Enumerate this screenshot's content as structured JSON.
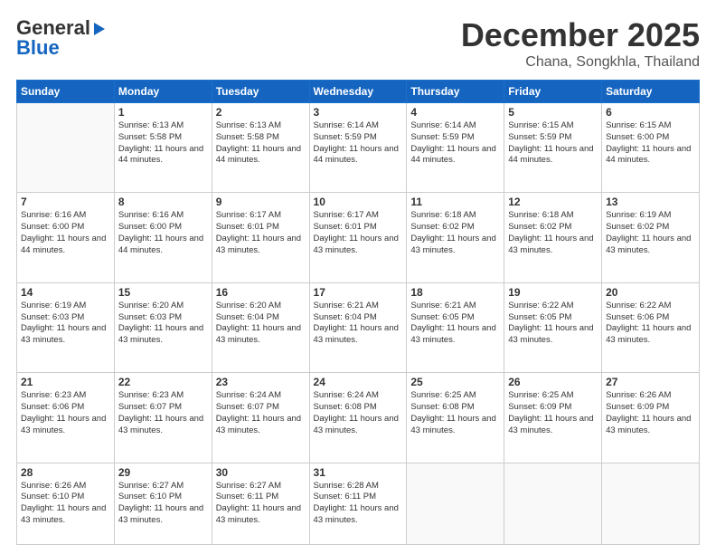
{
  "header": {
    "logo_line1": "General",
    "logo_line2": "Blue",
    "month": "December 2025",
    "location": "Chana, Songkhla, Thailand"
  },
  "days_of_week": [
    "Sunday",
    "Monday",
    "Tuesday",
    "Wednesday",
    "Thursday",
    "Friday",
    "Saturday"
  ],
  "weeks": [
    [
      {
        "day": "",
        "info": ""
      },
      {
        "day": "1",
        "info": "Sunrise: 6:13 AM\nSunset: 5:58 PM\nDaylight: 11 hours and 44 minutes."
      },
      {
        "day": "2",
        "info": "Sunrise: 6:13 AM\nSunset: 5:58 PM\nDaylight: 11 hours and 44 minutes."
      },
      {
        "day": "3",
        "info": "Sunrise: 6:14 AM\nSunset: 5:59 PM\nDaylight: 11 hours and 44 minutes."
      },
      {
        "day": "4",
        "info": "Sunrise: 6:14 AM\nSunset: 5:59 PM\nDaylight: 11 hours and 44 minutes."
      },
      {
        "day": "5",
        "info": "Sunrise: 6:15 AM\nSunset: 5:59 PM\nDaylight: 11 hours and 44 minutes."
      },
      {
        "day": "6",
        "info": "Sunrise: 6:15 AM\nSunset: 6:00 PM\nDaylight: 11 hours and 44 minutes."
      }
    ],
    [
      {
        "day": "7",
        "info": "Sunrise: 6:16 AM\nSunset: 6:00 PM\nDaylight: 11 hours and 44 minutes."
      },
      {
        "day": "8",
        "info": "Sunrise: 6:16 AM\nSunset: 6:00 PM\nDaylight: 11 hours and 44 minutes."
      },
      {
        "day": "9",
        "info": "Sunrise: 6:17 AM\nSunset: 6:01 PM\nDaylight: 11 hours and 43 minutes."
      },
      {
        "day": "10",
        "info": "Sunrise: 6:17 AM\nSunset: 6:01 PM\nDaylight: 11 hours and 43 minutes."
      },
      {
        "day": "11",
        "info": "Sunrise: 6:18 AM\nSunset: 6:02 PM\nDaylight: 11 hours and 43 minutes."
      },
      {
        "day": "12",
        "info": "Sunrise: 6:18 AM\nSunset: 6:02 PM\nDaylight: 11 hours and 43 minutes."
      },
      {
        "day": "13",
        "info": "Sunrise: 6:19 AM\nSunset: 6:02 PM\nDaylight: 11 hours and 43 minutes."
      }
    ],
    [
      {
        "day": "14",
        "info": "Sunrise: 6:19 AM\nSunset: 6:03 PM\nDaylight: 11 hours and 43 minutes."
      },
      {
        "day": "15",
        "info": "Sunrise: 6:20 AM\nSunset: 6:03 PM\nDaylight: 11 hours and 43 minutes."
      },
      {
        "day": "16",
        "info": "Sunrise: 6:20 AM\nSunset: 6:04 PM\nDaylight: 11 hours and 43 minutes."
      },
      {
        "day": "17",
        "info": "Sunrise: 6:21 AM\nSunset: 6:04 PM\nDaylight: 11 hours and 43 minutes."
      },
      {
        "day": "18",
        "info": "Sunrise: 6:21 AM\nSunset: 6:05 PM\nDaylight: 11 hours and 43 minutes."
      },
      {
        "day": "19",
        "info": "Sunrise: 6:22 AM\nSunset: 6:05 PM\nDaylight: 11 hours and 43 minutes."
      },
      {
        "day": "20",
        "info": "Sunrise: 6:22 AM\nSunset: 6:06 PM\nDaylight: 11 hours and 43 minutes."
      }
    ],
    [
      {
        "day": "21",
        "info": "Sunrise: 6:23 AM\nSunset: 6:06 PM\nDaylight: 11 hours and 43 minutes."
      },
      {
        "day": "22",
        "info": "Sunrise: 6:23 AM\nSunset: 6:07 PM\nDaylight: 11 hours and 43 minutes."
      },
      {
        "day": "23",
        "info": "Sunrise: 6:24 AM\nSunset: 6:07 PM\nDaylight: 11 hours and 43 minutes."
      },
      {
        "day": "24",
        "info": "Sunrise: 6:24 AM\nSunset: 6:08 PM\nDaylight: 11 hours and 43 minutes."
      },
      {
        "day": "25",
        "info": "Sunrise: 6:25 AM\nSunset: 6:08 PM\nDaylight: 11 hours and 43 minutes."
      },
      {
        "day": "26",
        "info": "Sunrise: 6:25 AM\nSunset: 6:09 PM\nDaylight: 11 hours and 43 minutes."
      },
      {
        "day": "27",
        "info": "Sunrise: 6:26 AM\nSunset: 6:09 PM\nDaylight: 11 hours and 43 minutes."
      }
    ],
    [
      {
        "day": "28",
        "info": "Sunrise: 6:26 AM\nSunset: 6:10 PM\nDaylight: 11 hours and 43 minutes."
      },
      {
        "day": "29",
        "info": "Sunrise: 6:27 AM\nSunset: 6:10 PM\nDaylight: 11 hours and 43 minutes."
      },
      {
        "day": "30",
        "info": "Sunrise: 6:27 AM\nSunset: 6:11 PM\nDaylight: 11 hours and 43 minutes."
      },
      {
        "day": "31",
        "info": "Sunrise: 6:28 AM\nSunset: 6:11 PM\nDaylight: 11 hours and 43 minutes."
      },
      {
        "day": "",
        "info": ""
      },
      {
        "day": "",
        "info": ""
      },
      {
        "day": "",
        "info": ""
      }
    ]
  ]
}
